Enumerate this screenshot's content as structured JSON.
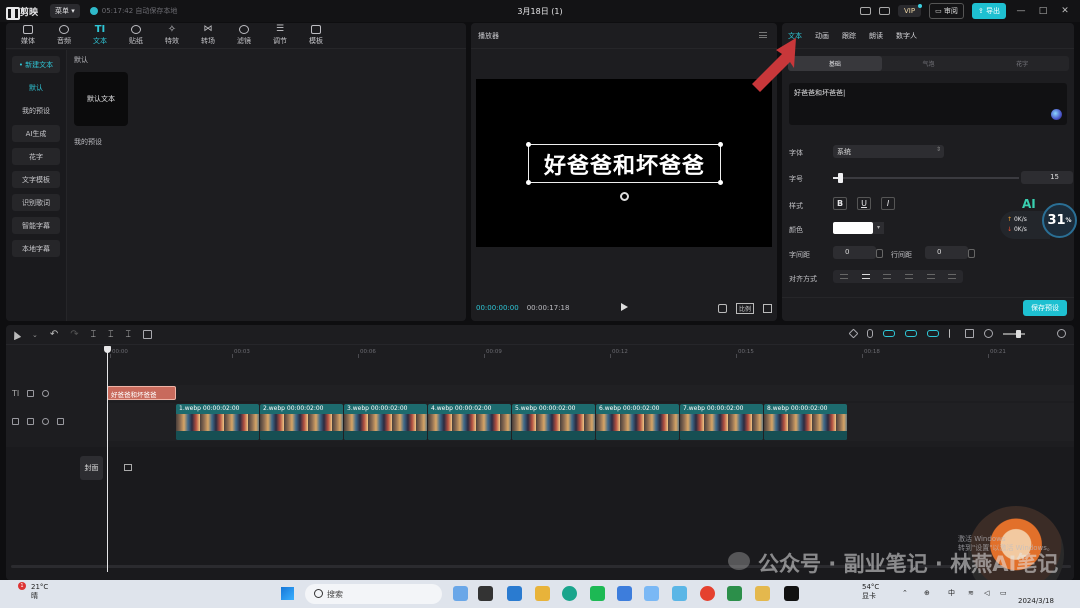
{
  "app": {
    "name": "剪映",
    "menu_label": "菜单",
    "save_status": "05:17:42 自动保存本地",
    "project_title": "3月18日 (1)",
    "vip_label": "VIP",
    "review_label": "审阅",
    "export_label": "导出",
    "window_controls": [
      "—",
      "□",
      "✕"
    ]
  },
  "toolbar": {
    "items": [
      {
        "label": "媒体",
        "icon": "media-icon"
      },
      {
        "label": "音频",
        "icon": "audio-icon"
      },
      {
        "label": "文本",
        "icon": "text-icon",
        "active": true
      },
      {
        "label": "贴纸",
        "icon": "sticker-icon"
      },
      {
        "label": "特效",
        "icon": "effects-icon"
      },
      {
        "label": "转场",
        "icon": "transition-icon"
      },
      {
        "label": "滤镜",
        "icon": "filter-icon"
      },
      {
        "label": "调节",
        "icon": "adjust-icon"
      },
      {
        "label": "模板",
        "icon": "template-icon"
      }
    ]
  },
  "text_nav": {
    "items": [
      "• 新建文本",
      "默认",
      "我的预设",
      "AI生成",
      "花字",
      "文字模板",
      "识别歌词",
      "智能字幕",
      "本地字幕"
    ]
  },
  "text_content": {
    "default_section": "默认",
    "default_card": "默认文本",
    "my_presets_section": "我的预设"
  },
  "player": {
    "title": "播放器",
    "overlay_text": "好爸爸和坏爸爸",
    "current_time": "00:00:00:00",
    "duration": "00:00:17:18",
    "ratio_label": "比例"
  },
  "inspector": {
    "tabs": [
      "文本",
      "动画",
      "跟踪",
      "朗读",
      "数字人"
    ],
    "active_tab": "文本",
    "segments": [
      "基础",
      "气泡",
      "花字"
    ],
    "text_value": "好爸爸和坏爸爸",
    "font_label": "字体",
    "font_value": "系统",
    "size_label": "字号",
    "size_value": "15",
    "size_level": 0.04,
    "style_label": "样式",
    "style_buttons": [
      "B",
      "U",
      "I"
    ],
    "color_label": "颜色",
    "color_value": "#ffffff",
    "char_spacing_label": "字间距",
    "char_spacing_value": "0",
    "line_spacing_label": "行间距",
    "line_spacing_value": "0",
    "align_label": "对齐方式",
    "save_preset_label": "保存预设"
  },
  "ai_widget": {
    "label": "AI",
    "up_speed": "0K/s",
    "down_speed": "0K/s",
    "percent": "31",
    "percent_unit": "%"
  },
  "timeline": {
    "ruler": [
      "00:00",
      "00:03",
      "00:06",
      "00:09",
      "00:12",
      "00:15",
      "00:18",
      "00:21"
    ],
    "text_clip": "好爸爸和坏爸爸",
    "clips": [
      {
        "name": "1.webp",
        "duration": "00:00:02:00"
      },
      {
        "name": "2.webp",
        "duration": "00:00:02:00"
      },
      {
        "name": "3.webp",
        "duration": "00:00:02:00"
      },
      {
        "name": "4.webp",
        "duration": "00:00:02:00"
      },
      {
        "name": "5.webp",
        "duration": "00:00:02:00"
      },
      {
        "name": "6.webp",
        "duration": "00:00:02:00"
      },
      {
        "name": "7.webp",
        "duration": "00:00:02:00"
      },
      {
        "name": "8.webp",
        "duration": "00:00:02:00"
      }
    ],
    "cover_label": "封面"
  },
  "overlay": {
    "watermark": "公众号 · 副业笔记 · 林燕AI笔记",
    "activation_line1": "激活 Windows",
    "activation_line2": "转到\"设置\"以激活 Windows。"
  },
  "taskbar": {
    "notification_count": "1",
    "temperature": "21°C",
    "weather": "晴",
    "search_placeholder": "搜索",
    "tray_temp": "54°C",
    "tray_status": "显卡",
    "ime": "中",
    "date": "2024/3/18"
  },
  "colors": {
    "accent": "#1ec0d1",
    "text_clip": "#c86a5c",
    "video_clip": "#1d6b6e",
    "arrow": "#c8373a"
  }
}
